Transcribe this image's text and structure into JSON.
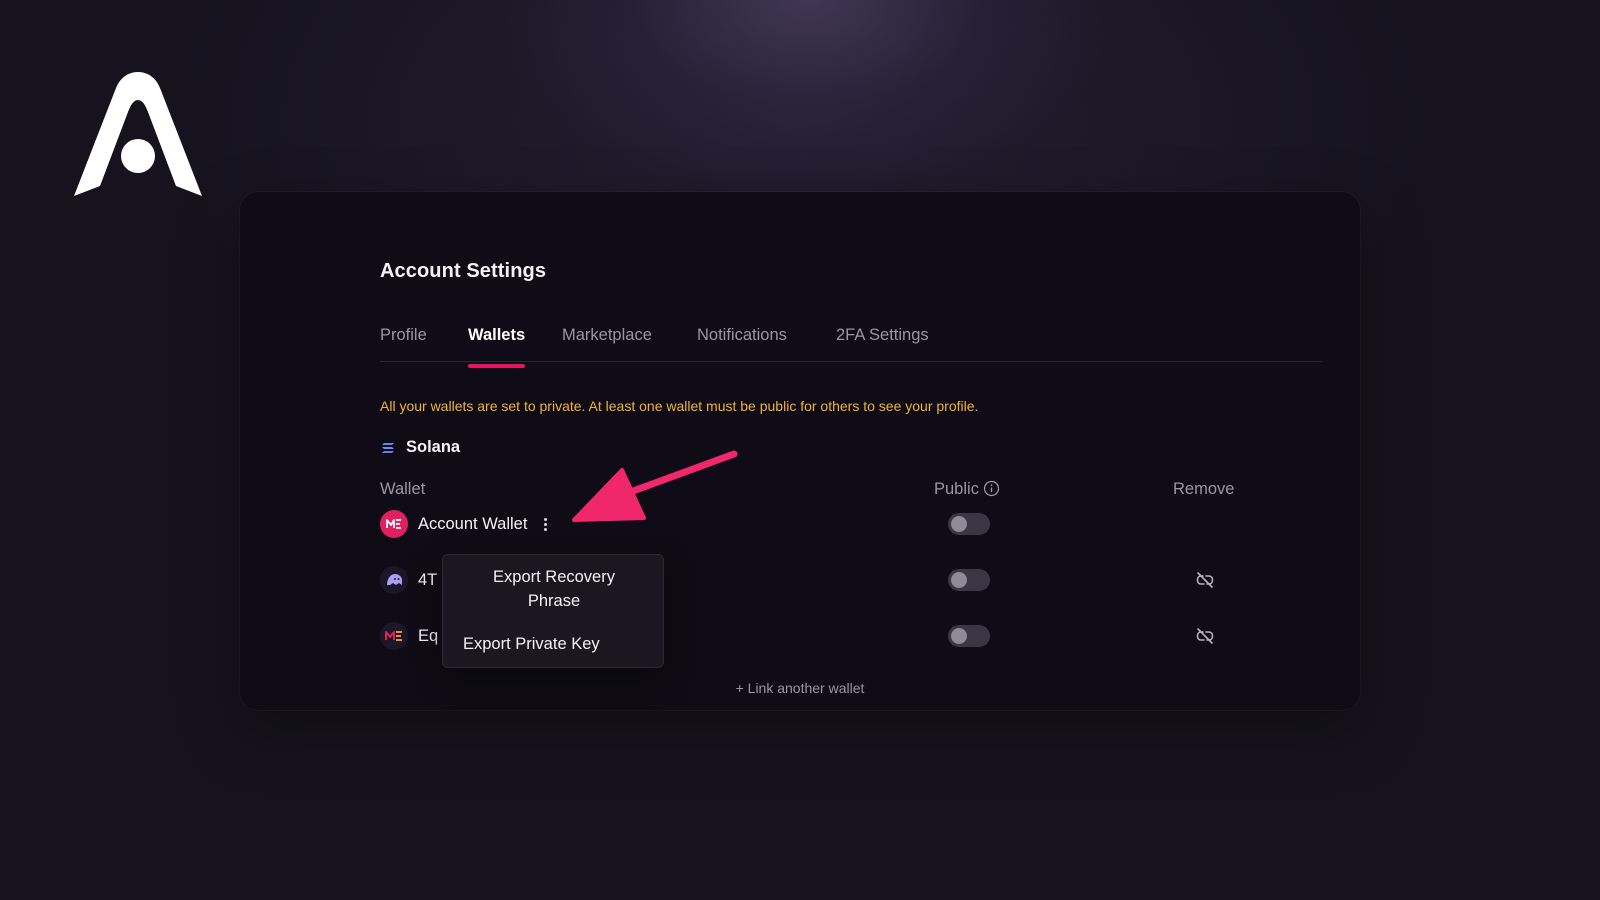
{
  "app": {
    "logo_name": "A"
  },
  "page": {
    "title": "Account Settings",
    "tabs": [
      {
        "label": "Profile",
        "active": false
      },
      {
        "label": "Wallets",
        "active": true
      },
      {
        "label": "Marketplace",
        "active": false
      },
      {
        "label": "Notifications",
        "active": false
      },
      {
        "label": "2FA Settings",
        "active": false
      }
    ],
    "warning": "All your wallets are set to private. At least one wallet must be public for others to see your profile.",
    "chain": {
      "name": "Solana",
      "icon": "solana-icon"
    },
    "columns": {
      "wallet": "Wallet",
      "public": "Public",
      "remove": "Remove"
    },
    "wallets": [
      {
        "name": "Account Wallet",
        "icon": "magic-eden-icon",
        "public": false,
        "removable": false
      },
      {
        "name": "4T",
        "icon": "phantom-icon",
        "public": false,
        "removable": true
      },
      {
        "name": "Eq",
        "icon": "magic-eden-icon",
        "public": false,
        "removable": true
      }
    ],
    "link_wallet": "+ Link another wallet"
  },
  "context_menu": {
    "items": [
      "Export Recovery Phrase",
      "Export Private Key"
    ]
  },
  "colors": {
    "accent": "#e4165f",
    "warning": "#f2b233",
    "background": "#16131f",
    "card": "#0f0c17"
  }
}
